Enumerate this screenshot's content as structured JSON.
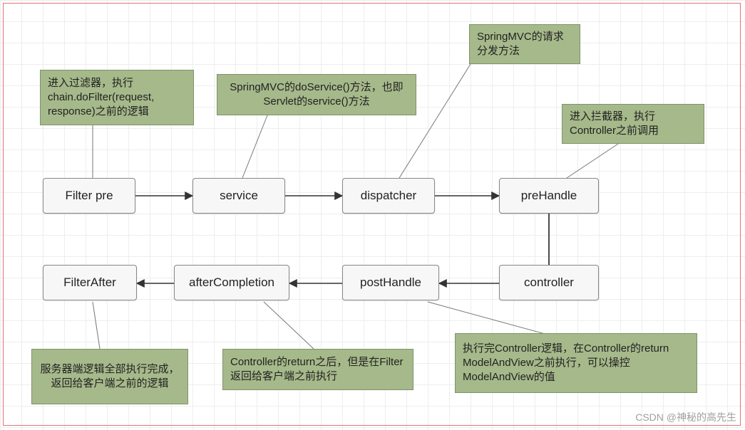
{
  "nodes": {
    "filter_pre": "Filter pre",
    "service": "service",
    "dispatcher": "dispatcher",
    "prehandle": "preHandle",
    "controller": "controller",
    "posthandle": "postHandle",
    "aftercompletion": "afterCompletion",
    "filterafter": "FilterAfter"
  },
  "notes": {
    "filter_pre_note": "进入过滤器，执行chain.doFilter(request, response)之前的逻辑",
    "service_note": "SpringMVC的doService()方法，也即Servlet的service()方法",
    "dispatcher_note": "SpringMVC的请求分发方法",
    "prehandle_note": "进入拦截器，执行Controller之前调用",
    "posthandle_note": "执行完Controller逻辑，在Controller的return ModelAndView之前执行，可以操控ModelAndView的值",
    "aftercompletion_note": "Controller的return之后，但是在Filter返回给客户端之前执行",
    "filterafter_note": "服务器端逻辑全部执行完成，返回给客户端之前的逻辑"
  },
  "watermark": "CSDN @神秘的高先生",
  "colors": {
    "note_bg": "#a6b98a",
    "node_bg": "#f7f7f7",
    "frame": "#e57373"
  }
}
